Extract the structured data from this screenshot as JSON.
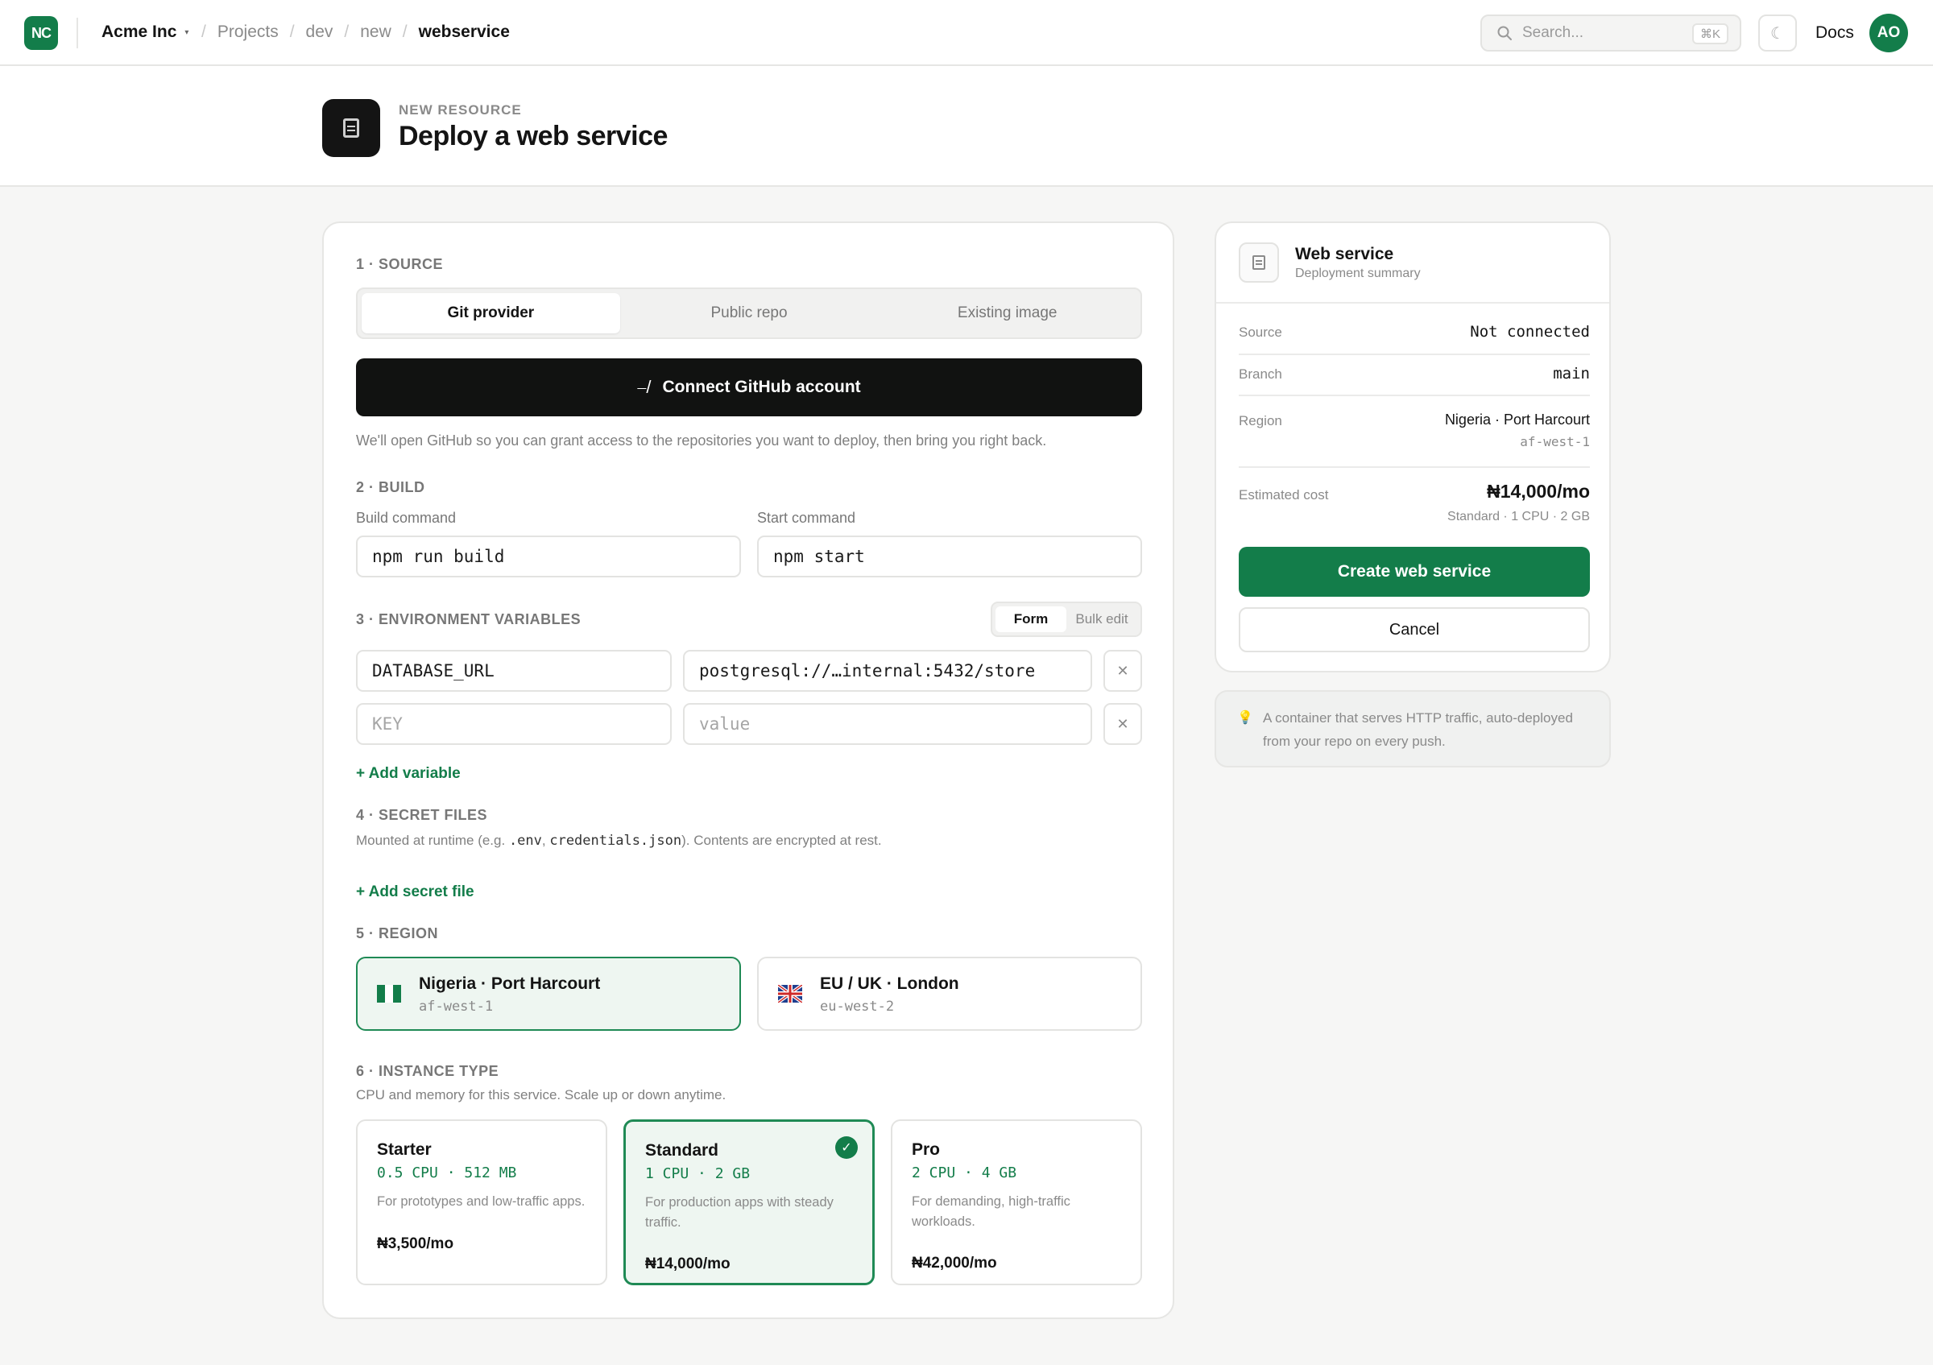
{
  "topbar": {
    "logo_text": "NC",
    "org_name": "Acme Inc",
    "org_caret": "▾",
    "breadcrumbs": [
      "Projects",
      "dev",
      "new",
      "webservice"
    ],
    "search_placeholder": "Search...",
    "search_shortcut": "⌘K",
    "theme_icon": "☾",
    "docs_label": "Docs",
    "avatar_initials": "AO"
  },
  "header": {
    "eyebrow": "NEW RESOURCE",
    "title": "Deploy a web service"
  },
  "source": {
    "title": "1 · SOURCE",
    "tabs": [
      "Git provider",
      "Public repo",
      "Existing image"
    ],
    "active_tab": "Git provider",
    "connect_icon": "⎯/",
    "connect_label": "Connect GitHub account",
    "hint": "We'll open GitHub so you can grant access to the repositories you want to deploy, then bring you right back."
  },
  "build": {
    "title": "2 · BUILD",
    "build_label": "Build command",
    "build_value": "npm run build",
    "start_label": "Start command",
    "start_value": "npm start"
  },
  "env": {
    "title": "3 · ENVIRONMENT VARIABLES",
    "modes": [
      "Form",
      "Bulk edit"
    ],
    "active_mode": "Form",
    "rows": [
      {
        "key": "DATABASE_URL",
        "value": "postgresql://…internal:5432/store"
      },
      {
        "key_placeholder": "KEY",
        "value_placeholder": "value"
      }
    ],
    "remove_icon": "✕",
    "add_label": "+ Add variable"
  },
  "secrets": {
    "title": "4 · SECRET FILES",
    "hint_before": "Mounted at runtime (e.g. ",
    "hint_code1": ".env",
    "hint_comma": ", ",
    "hint_code2": "credentials.json",
    "hint_after": "). Contents are encrypted at rest.",
    "add_label": "+ Add secret file"
  },
  "region": {
    "title": "5 · REGION",
    "options": [
      {
        "name": "Nigeria · Port Harcourt",
        "code": "af-west-1",
        "selected": true
      },
      {
        "name": "EU / UK · London",
        "code": "eu-west-2",
        "selected": false
      }
    ]
  },
  "instance": {
    "title": "6 · INSTANCE TYPE",
    "hint": "CPU and memory for this service. Scale up or down anytime.",
    "plans": [
      {
        "name": "Starter",
        "spec": "0.5 CPU · 512 MB",
        "desc": "For prototypes and low-traffic apps.",
        "price": "₦3,500/mo",
        "selected": false
      },
      {
        "name": "Standard",
        "spec": "1 CPU · 2 GB",
        "desc": "For production apps with steady traffic.",
        "price": "₦14,000/mo",
        "selected": true
      },
      {
        "name": "Pro",
        "spec": "2 CPU · 4 GB",
        "desc": "For demanding, high-traffic workloads.",
        "price": "₦42,000/mo",
        "selected": false
      }
    ],
    "check_icon": "✓"
  },
  "summary": {
    "title": "Web service",
    "subtitle": "Deployment summary",
    "source_label": "Source",
    "source_value": "Not connected",
    "branch_label": "Branch",
    "branch_value": "main",
    "region_label": "Region",
    "region_value": "Nigeria · Port Harcourt",
    "region_code": "af-west-1",
    "cost_label": "Estimated cost",
    "cost_value": "₦14,000/mo",
    "cost_detail": "Standard · 1 CPU · 2 GB",
    "create_label": "Create web service",
    "cancel_label": "Cancel"
  },
  "tip": {
    "icon": "💡",
    "text": "A container that serves HTTP traffic, auto-deployed from your repo on every push."
  },
  "colors": {
    "accent": "#137d4a",
    "selected_bg": "#eef6f1",
    "dark_button": "#111211"
  }
}
